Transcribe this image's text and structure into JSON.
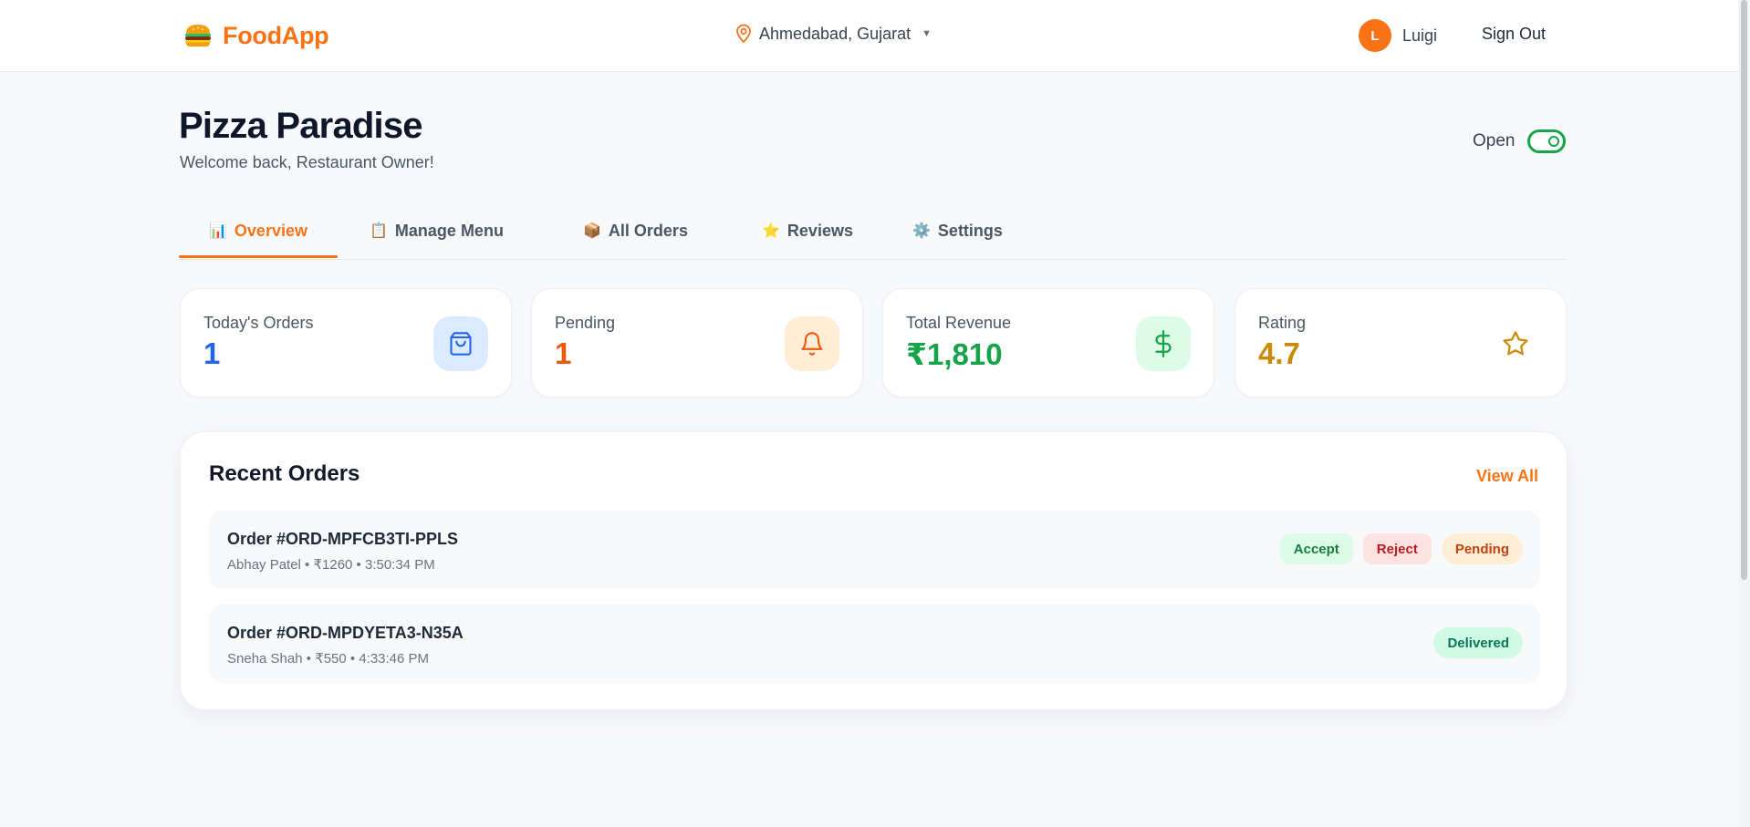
{
  "header": {
    "app_name": "FoodApp",
    "location": "Ahmedabad, Gujarat",
    "user_initial": "L",
    "user_name": "Luigi",
    "sign_out": "Sign Out"
  },
  "page": {
    "title": "Pizza Paradise",
    "subtitle": "Welcome back, Restaurant Owner!",
    "status_label": "Open",
    "is_open": true
  },
  "tabs": [
    {
      "icon": "📊",
      "label": "Overview",
      "active": true
    },
    {
      "icon": "📋",
      "label": "Manage Menu",
      "active": false
    },
    {
      "icon": "📦",
      "label": "All Orders",
      "active": false
    },
    {
      "icon": "⭐",
      "label": "Reviews",
      "active": false
    },
    {
      "icon": "⚙️",
      "label": "Settings",
      "active": false
    }
  ],
  "stats": [
    {
      "label": "Today's Orders",
      "value": "1",
      "icon": "shopping-bag-icon",
      "color": "#2563eb",
      "bg": "#dbeafe"
    },
    {
      "label": "Pending",
      "value": "1",
      "icon": "bell-icon",
      "color": "#ea580c",
      "bg": "#ffedd5"
    },
    {
      "label": "Total Revenue",
      "value": "₹1,810",
      "icon": "dollar-icon",
      "color": "#16a34a",
      "bg": "#dcfce7"
    },
    {
      "label": "Rating",
      "value": "4.7",
      "icon": "star-icon",
      "color": "#ca8a04",
      "bg": "#ffffff"
    }
  ],
  "recent_orders": {
    "title": "Recent Orders",
    "view_all": "View All",
    "orders": [
      {
        "id": "Order #ORD-MPFCB3TI-PPLS",
        "meta": "Abhay Patel • ₹1260 • 3:50:34 PM",
        "accept": "Accept",
        "reject": "Reject",
        "status": "Pending"
      },
      {
        "id": "Order #ORD-MPDYETA3-N35A",
        "meta": "Sneha Shah • ₹550 • 4:33:46 PM",
        "status": "Delivered"
      }
    ]
  },
  "colors": {
    "accent": "#f97316",
    "success": "#16a34a",
    "text": "#111827"
  }
}
